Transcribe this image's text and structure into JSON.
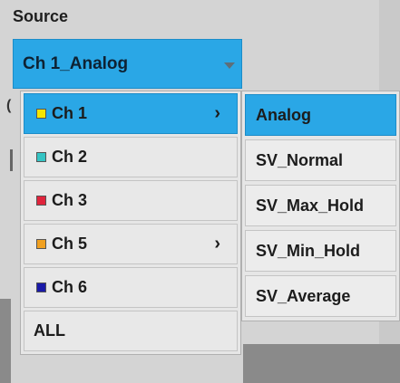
{
  "source": {
    "label": "Source",
    "selected_value": "Ch 1_Analog"
  },
  "channel_menu": {
    "items": [
      {
        "label": "Ch 1",
        "color": "#f5e600",
        "has_submenu": true,
        "selected": true
      },
      {
        "label": "Ch 2",
        "color": "#35c4c4",
        "has_submenu": false,
        "selected": false
      },
      {
        "label": "Ch 3",
        "color": "#e0243c",
        "has_submenu": false,
        "selected": false
      },
      {
        "label": "Ch 5",
        "color": "#f0a020",
        "has_submenu": true,
        "selected": false
      },
      {
        "label": "Ch 6",
        "color": "#1a1aa8",
        "has_submenu": false,
        "selected": false
      },
      {
        "label": "ALL",
        "color": null,
        "has_submenu": false,
        "selected": false
      }
    ],
    "arrow_glyph": "›"
  },
  "sub_menu": {
    "items": [
      {
        "label": "Analog",
        "selected": true
      },
      {
        "label": "SV_Normal",
        "selected": false
      },
      {
        "label": "SV_Max_Hold",
        "selected": false
      },
      {
        "label": "SV_Min_Hold",
        "selected": false
      },
      {
        "label": "SV_Average",
        "selected": false
      }
    ]
  },
  "colors": {
    "accent": "#2aa7e6",
    "menu_bg": "#e8e8e8"
  }
}
